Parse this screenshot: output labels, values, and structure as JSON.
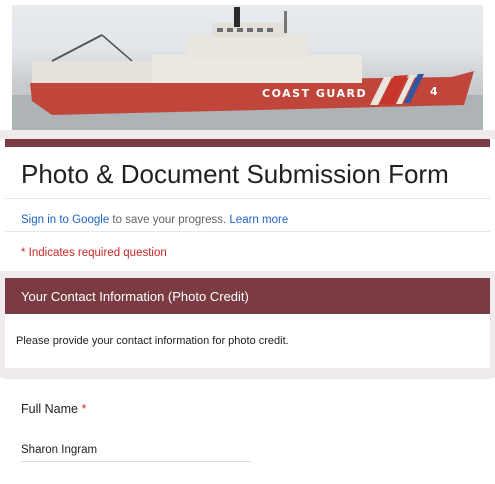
{
  "banner": {
    "image_subject": "coast-guard-cutter-ship",
    "hull_text": "COAST GUARD",
    "hull_number": "4",
    "colors": {
      "hull": "#c0463b",
      "superstructure": "#e9e6df",
      "stripe_red": "#c8352b",
      "stripe_blue": "#2f55a4"
    }
  },
  "form": {
    "title": "Photo & Document Submission Form",
    "signin_link": "Sign in to Google",
    "signin_text": " to save your progress. ",
    "learn_more": "Learn more",
    "required_note": "* Indicates required question"
  },
  "section": {
    "title": "Your Contact Information (Photo Credit)",
    "description": "Please provide your contact information for photo credit."
  },
  "question": {
    "label": "Full Name",
    "required_marker": "*",
    "value": "Sharon Ingram"
  },
  "colors": {
    "accent": "#7a3b42",
    "link": "#1a62c7",
    "required": "#c62828",
    "page_bg": "#f0ebec"
  }
}
